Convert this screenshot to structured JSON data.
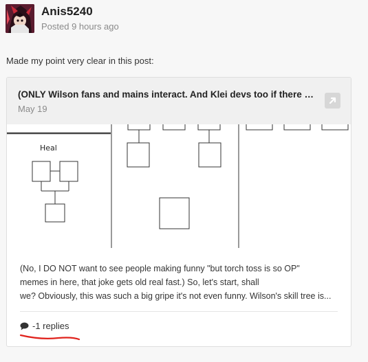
{
  "author": {
    "username": "Anis5240",
    "posted": "Posted 9 hours ago"
  },
  "post": {
    "text": "Made my point very clear in this post:"
  },
  "embed": {
    "title": "(ONLY Wilson fans and mains interact. And Klei devs too if there are any)",
    "date": "May 19",
    "drawing_label": "Heal",
    "excerpt_lines": [
      "(No, I DO NOT want to see people making funny \"but torch toss is so OP\"",
      "memes in here, that joke gets old real fast.) So, let's start, shall",
      "we? Obviously, this was such a big gripe it's not even funny. Wilson's skill tree is..."
    ],
    "replies": "-1 replies"
  },
  "colors": {
    "accent_underline": "#e0221c",
    "embed_header_bg": "#f0f0f0"
  }
}
